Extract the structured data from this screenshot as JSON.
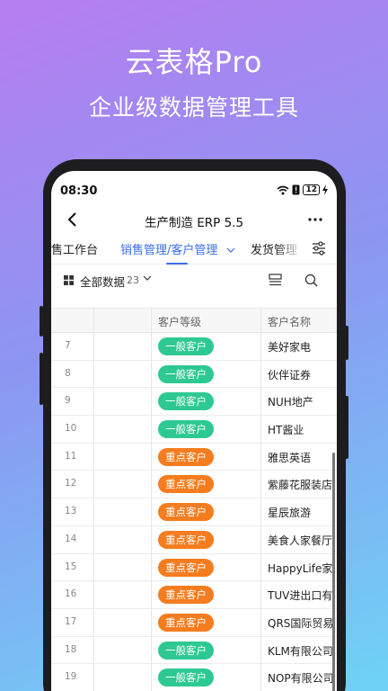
{
  "promo": {
    "title": "云表格Pro",
    "subtitle": "企业级数据管理工具"
  },
  "status_bar": {
    "time": "08:30",
    "battery": "12"
  },
  "nav": {
    "title": "生产制造 ERP 5.5"
  },
  "tabs": [
    {
      "label": "销售工作台"
    },
    {
      "label": "销售管理/客户管理"
    },
    {
      "label": "发货管理"
    }
  ],
  "view": {
    "label": "全部数据",
    "count": "23"
  },
  "table": {
    "columns": [
      "客户等级",
      "客户名称"
    ],
    "rows": [
      {
        "idx": "7",
        "level": "一般客户",
        "name": "美好家电"
      },
      {
        "idx": "8",
        "level": "一般客户",
        "name": "伙伴证券"
      },
      {
        "idx": "9",
        "level": "一般客户",
        "name": "NUH地产"
      },
      {
        "idx": "10",
        "level": "一般客户",
        "name": "HT酱业"
      },
      {
        "idx": "11",
        "level": "重点客户",
        "name": "雅思英语"
      },
      {
        "idx": "12",
        "level": "重点客户",
        "name": "紫藤花服装店"
      },
      {
        "idx": "13",
        "level": "重点客户",
        "name": "星辰旅游"
      },
      {
        "idx": "14",
        "level": "重点客户",
        "name": "美食人家餐厅"
      },
      {
        "idx": "15",
        "level": "重点客户",
        "name": "HappyLife家"
      },
      {
        "idx": "16",
        "level": "重点客户",
        "name": "TUV进出口有"
      },
      {
        "idx": "17",
        "level": "重点客户",
        "name": "QRS国际贸易"
      },
      {
        "idx": "18",
        "level": "一般客户",
        "name": "KLM有限公司"
      },
      {
        "idx": "19",
        "level": "一般客户",
        "name": "NOP有限公司"
      }
    ]
  },
  "colors": {
    "accent": "#3c6cf0",
    "normal_badge": "#2ec993",
    "key_badge": "#f57c1f"
  }
}
